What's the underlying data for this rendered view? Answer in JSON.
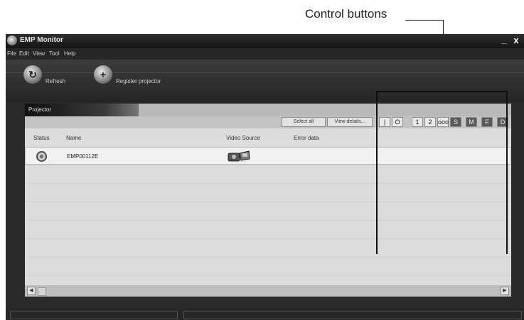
{
  "callout": {
    "label": "Control buttons"
  },
  "window": {
    "title": "EMP Monitor",
    "min_glyph": "_",
    "close_glyph": "x"
  },
  "menu": [
    "File",
    "Edit",
    "View",
    "Tool",
    "Help"
  ],
  "toolbar": {
    "refresh_label": "Refresh",
    "register_label": "Register projector"
  },
  "panel": {
    "tab_label": "Projector",
    "select_all_label": "Select all",
    "view_details_label": "View details...",
    "controls": [
      {
        "icon": "power-on-icon",
        "glyph": "|"
      },
      {
        "icon": "power-off-icon",
        "glyph": "O"
      },
      {
        "icon": "computer-1-source-icon",
        "glyph": "1"
      },
      {
        "icon": "computer-2-source-icon",
        "glyph": "2"
      },
      {
        "icon": "video-source-icon",
        "glyph": "ooo"
      },
      {
        "icon": "s-video-source-icon",
        "glyph": "S"
      },
      {
        "icon": "av-mute-icon",
        "glyph": "M"
      },
      {
        "icon": "freeze-icon",
        "glyph": "F"
      },
      {
        "icon": "display-icon",
        "glyph": "D"
      }
    ],
    "columns": [
      "Status",
      "Name",
      "Video Source",
      "Error data"
    ],
    "rows": [
      {
        "status_icon": "status-icon",
        "name": "EMP00112E",
        "video_icon": "video-source-icon",
        "error": ""
      }
    ]
  },
  "colors": {
    "window_bg": "#2a2a2a",
    "panel_bg": "#dcdcdc",
    "selected_row": "#f1f1f1"
  }
}
